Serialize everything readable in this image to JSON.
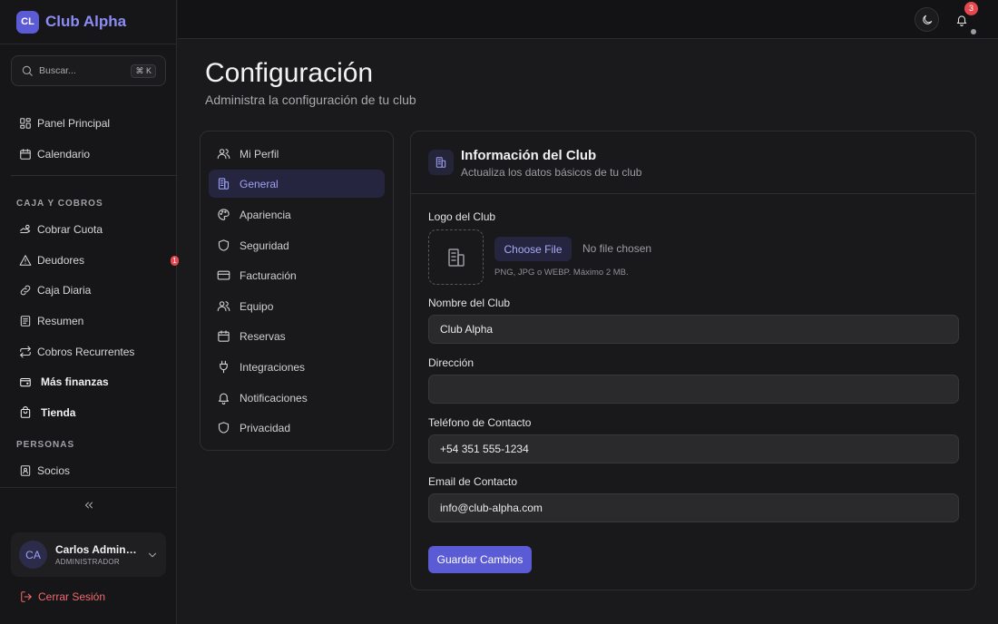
{
  "brand": {
    "logo": "CL",
    "name": "Club Alpha"
  },
  "search": {
    "placeholder": "Buscar...",
    "shortcut": "⌘ K"
  },
  "sidebar": {
    "top_items": [
      {
        "label": "Panel Principal",
        "icon": "grid-icon"
      },
      {
        "label": "Calendario",
        "icon": "calendar-icon"
      }
    ],
    "section_caja": "CAJA Y COBROS",
    "caja_items": [
      {
        "label": "Cobrar Cuota",
        "icon": "hand-coins-icon"
      },
      {
        "label": "Deudores",
        "icon": "alert-triangle-icon",
        "badge": "1"
      },
      {
        "label": "Caja Diaria",
        "icon": "link-icon"
      },
      {
        "label": "Resumen",
        "icon": "receipt-icon"
      },
      {
        "label": "Cobros Recurrentes",
        "icon": "repeat-icon"
      },
      {
        "label": "Más finanzas",
        "icon": "wallet-icon"
      },
      {
        "label": "Tienda",
        "icon": "shopping-bag-icon"
      }
    ],
    "section_personas": "PERSONAS",
    "personas_items": [
      {
        "label": "Socios",
        "icon": "id-card-icon"
      }
    ]
  },
  "user": {
    "initials": "CA",
    "name": "Carlos Administrador",
    "role": "ADMINISTRADOR"
  },
  "logout_label": "Cerrar Sesión",
  "topbar": {
    "notifications": "3"
  },
  "header": {
    "title": "Configuración",
    "subtitle": "Administra la configuración de tu club"
  },
  "settings_nav": [
    {
      "label": "Mi Perfil",
      "icon": "users-icon"
    },
    {
      "label": "General",
      "icon": "building-icon",
      "active": true
    },
    {
      "label": "Apariencia",
      "icon": "palette-icon"
    },
    {
      "label": "Seguridad",
      "icon": "shield-icon"
    },
    {
      "label": "Facturación",
      "icon": "credit-card-icon"
    },
    {
      "label": "Equipo",
      "icon": "users-icon"
    },
    {
      "label": "Reservas",
      "icon": "calendar-icon"
    },
    {
      "label": "Integraciones",
      "icon": "plug-icon"
    },
    {
      "label": "Notificaciones",
      "icon": "bell-icon"
    },
    {
      "label": "Privacidad",
      "icon": "shield-icon"
    }
  ],
  "card": {
    "title": "Información del Club",
    "subtitle": "Actualiza los datos básicos de tu club",
    "logo_label": "Logo del Club",
    "choose_file": "Choose File",
    "no_file": "No file chosen",
    "hint": "PNG, JPG o WEBP. Máximo 2 MB.",
    "fields": {
      "name": {
        "label": "Nombre del Club",
        "value": "Club Alpha"
      },
      "address": {
        "label": "Dirección",
        "value": ""
      },
      "phone": {
        "label": "Teléfono de Contacto",
        "value": "+54 351 555-1234"
      },
      "email": {
        "label": "Email de Contacto",
        "value": "info@club-alpha.com"
      }
    },
    "save": "Guardar Cambios"
  },
  "colors": {
    "accent": "#5b5bd6",
    "accent_text": "#9fa1f7",
    "danger": "#e5484d",
    "background": "#1a1a1c"
  }
}
